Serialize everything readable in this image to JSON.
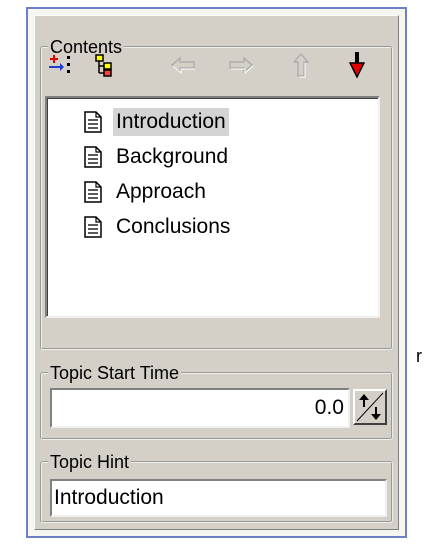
{
  "stray_glyph": "r",
  "contents": {
    "legend": "Contents",
    "toolbar": [
      {
        "name": "add-topic-button",
        "icon": "add-topic-icon",
        "enabled": true
      },
      {
        "name": "topic-tree-button",
        "icon": "topic-tree-icon",
        "enabled": true
      },
      {
        "name": "move-left-button",
        "icon": "arrow-left-icon",
        "enabled": false
      },
      {
        "name": "move-right-button",
        "icon": "arrow-right-icon",
        "enabled": false
      },
      {
        "name": "move-up-button",
        "icon": "arrow-up-icon",
        "enabled": false
      },
      {
        "name": "move-down-button",
        "icon": "arrow-down-icon",
        "enabled": true
      }
    ],
    "items": [
      {
        "label": "Introduction",
        "selected": true
      },
      {
        "label": "Background",
        "selected": false
      },
      {
        "label": "Approach",
        "selected": false
      },
      {
        "label": "Conclusions",
        "selected": false
      }
    ]
  },
  "topic_start_time": {
    "legend": "Topic Start Time",
    "value": "0.0"
  },
  "topic_hint": {
    "legend": "Topic Hint",
    "value": "Introduction"
  },
  "colors": {
    "frame": "#6f7fc7",
    "panel": "#d4d0c8",
    "down_arrow": "#e00000",
    "add_red": "#e00000",
    "add_blue": "#1f3fd0"
  }
}
